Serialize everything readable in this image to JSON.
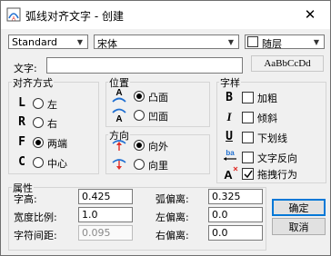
{
  "window": {
    "title": "弧线对齐文字 - 创建",
    "close_symbol": "✕"
  },
  "toolbar": {
    "style_combo": "Standard",
    "font_combo": "宋体",
    "follow_layer_label": "随层",
    "follow_layer_checked": false
  },
  "text_row": {
    "label": "文字:",
    "value": "",
    "preview": "AaBbCcDd"
  },
  "alignment": {
    "title": "对齐方式",
    "items": [
      {
        "icon": "L",
        "label": "左",
        "selected": false
      },
      {
        "icon": "R",
        "label": "右",
        "selected": false
      },
      {
        "icon": "F",
        "label": "两端",
        "selected": true
      },
      {
        "icon": "C",
        "label": "中心",
        "selected": false
      }
    ]
  },
  "position": {
    "title": "位置",
    "items": [
      {
        "label": "凸面",
        "selected": true
      },
      {
        "label": "凹面",
        "selected": false
      }
    ]
  },
  "direction": {
    "title": "方向",
    "items": [
      {
        "label": "向外",
        "selected": true
      },
      {
        "label": "向里",
        "selected": false
      }
    ]
  },
  "style": {
    "title": "字样",
    "items": [
      {
        "icon": "B",
        "label": "加粗",
        "checked": false
      },
      {
        "icon": "I",
        "label": "倾斜",
        "checked": false
      },
      {
        "icon": "U",
        "label": "下划线",
        "checked": false
      }
    ],
    "reverse": {
      "icon_text": "ba",
      "label": "文字反向",
      "checked": false
    },
    "drag": {
      "icon_text": "A",
      "label": "拖拽行为",
      "checked": true
    }
  },
  "properties": {
    "title": "属性",
    "left": [
      {
        "label": "字高:",
        "value": "0.425",
        "disabled": false
      },
      {
        "label": "宽度比例:",
        "value": "1.0",
        "disabled": false
      },
      {
        "label": "字符间距:",
        "value": "0.095",
        "disabled": true
      }
    ],
    "right": [
      {
        "label": "弧偏离:",
        "value": "0.325"
      },
      {
        "label": "左偏离:",
        "value": "0.0"
      },
      {
        "label": "右偏离:",
        "value": "0.0"
      }
    ]
  },
  "buttons": {
    "ok": "确定",
    "cancel": "取消"
  },
  "colors": {
    "accent": "#0078d7",
    "icon_blue": "#1f6fd1",
    "icon_red": "#e0302a"
  }
}
